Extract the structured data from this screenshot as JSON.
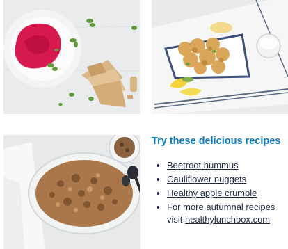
{
  "section": {
    "heading": "Try these delicious recipes"
  },
  "recipes": [
    {
      "label": "Beetroot hummus"
    },
    {
      "label": "Cauliflower nuggets"
    },
    {
      "label": "Healthy apple crumble"
    }
  ],
  "more": {
    "prefix": "For more autumnal recipes",
    "visit": "visit ",
    "link": "healthylunchbox.com"
  },
  "colors": {
    "heading": "#0a7ec2",
    "text": "#1e2a44"
  }
}
